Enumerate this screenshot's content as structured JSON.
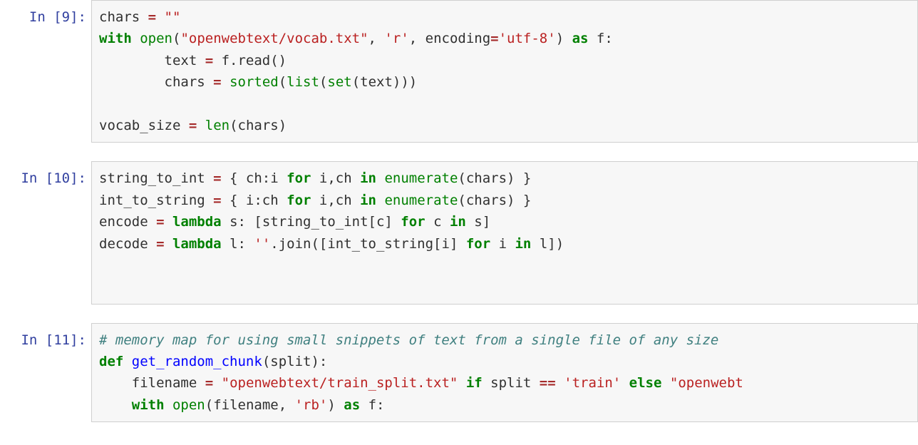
{
  "cells": [
    {
      "prompt": "In [9]:",
      "tokens": [
        {
          "t": "chars "
        },
        {
          "t": "=",
          "c": "op"
        },
        {
          "t": " "
        },
        {
          "t": "\"\"",
          "c": "str"
        },
        {
          "t": "\n"
        },
        {
          "t": "with",
          "c": "kw"
        },
        {
          "t": " "
        },
        {
          "t": "open",
          "c": "bi"
        },
        {
          "t": "("
        },
        {
          "t": "\"openwebtext/vocab.txt\"",
          "c": "str"
        },
        {
          "t": ", "
        },
        {
          "t": "'r'",
          "c": "str"
        },
        {
          "t": ", encoding"
        },
        {
          "t": "=",
          "c": "op"
        },
        {
          "t": "'utf-8'",
          "c": "str"
        },
        {
          "t": ") "
        },
        {
          "t": "as",
          "c": "kw"
        },
        {
          "t": " f:\n"
        },
        {
          "t": "        text "
        },
        {
          "t": "=",
          "c": "op"
        },
        {
          "t": " f.read()\n"
        },
        {
          "t": "        chars "
        },
        {
          "t": "=",
          "c": "op"
        },
        {
          "t": " "
        },
        {
          "t": "sorted",
          "c": "bi"
        },
        {
          "t": "("
        },
        {
          "t": "list",
          "c": "bi"
        },
        {
          "t": "("
        },
        {
          "t": "set",
          "c": "bi"
        },
        {
          "t": "(text)))\n"
        },
        {
          "t": "\n"
        },
        {
          "t": "vocab_size "
        },
        {
          "t": "=",
          "c": "op"
        },
        {
          "t": " "
        },
        {
          "t": "len",
          "c": "bi"
        },
        {
          "t": "(chars)"
        }
      ]
    },
    {
      "prompt": "In [10]:",
      "tokens": [
        {
          "t": "string_to_int "
        },
        {
          "t": "=",
          "c": "op"
        },
        {
          "t": " { ch:i "
        },
        {
          "t": "for",
          "c": "kw"
        },
        {
          "t": " i,ch "
        },
        {
          "t": "in",
          "c": "kw"
        },
        {
          "t": " "
        },
        {
          "t": "enumerate",
          "c": "bi"
        },
        {
          "t": "(chars) }\n"
        },
        {
          "t": "int_to_string "
        },
        {
          "t": "=",
          "c": "op"
        },
        {
          "t": " { i:ch "
        },
        {
          "t": "for",
          "c": "kw"
        },
        {
          "t": " i,ch "
        },
        {
          "t": "in",
          "c": "kw"
        },
        {
          "t": " "
        },
        {
          "t": "enumerate",
          "c": "bi"
        },
        {
          "t": "(chars) }\n"
        },
        {
          "t": "encode "
        },
        {
          "t": "=",
          "c": "op"
        },
        {
          "t": " "
        },
        {
          "t": "lambda",
          "c": "kw"
        },
        {
          "t": " s: [string_to_int[c] "
        },
        {
          "t": "for",
          "c": "kw"
        },
        {
          "t": " c "
        },
        {
          "t": "in",
          "c": "kw"
        },
        {
          "t": " s]\n"
        },
        {
          "t": "decode "
        },
        {
          "t": "=",
          "c": "op"
        },
        {
          "t": " "
        },
        {
          "t": "lambda",
          "c": "kw"
        },
        {
          "t": " l: "
        },
        {
          "t": "''",
          "c": "str"
        },
        {
          "t": ".join([int_to_string[i] "
        },
        {
          "t": "for",
          "c": "kw"
        },
        {
          "t": " i "
        },
        {
          "t": "in",
          "c": "kw"
        },
        {
          "t": " l])\n"
        },
        {
          "t": "\n"
        },
        {
          "t": "\n"
        }
      ]
    },
    {
      "prompt": "In [11]:",
      "tokens": [
        {
          "t": "# memory map for using small snippets of text from a single file of any size",
          "c": "cm"
        },
        {
          "t": "\n"
        },
        {
          "t": "def",
          "c": "kw"
        },
        {
          "t": " "
        },
        {
          "t": "get_random_chunk",
          "c": "fn"
        },
        {
          "t": "(split):\n"
        },
        {
          "t": "    filename "
        },
        {
          "t": "=",
          "c": "op"
        },
        {
          "t": " "
        },
        {
          "t": "\"openwebtext/train_split.txt\"",
          "c": "str"
        },
        {
          "t": " "
        },
        {
          "t": "if",
          "c": "kw"
        },
        {
          "t": " split "
        },
        {
          "t": "==",
          "c": "op"
        },
        {
          "t": " "
        },
        {
          "t": "'train'",
          "c": "str"
        },
        {
          "t": " "
        },
        {
          "t": "else",
          "c": "kw"
        },
        {
          "t": " "
        },
        {
          "t": "\"openwebt",
          "c": "str"
        },
        {
          "t": "\n"
        },
        {
          "t": "    "
        },
        {
          "t": "with",
          "c": "kw"
        },
        {
          "t": " "
        },
        {
          "t": "open",
          "c": "bi"
        },
        {
          "t": "(filename, "
        },
        {
          "t": "'rb'",
          "c": "str"
        },
        {
          "t": ") "
        },
        {
          "t": "as",
          "c": "kw"
        },
        {
          "t": " f:"
        }
      ]
    }
  ]
}
